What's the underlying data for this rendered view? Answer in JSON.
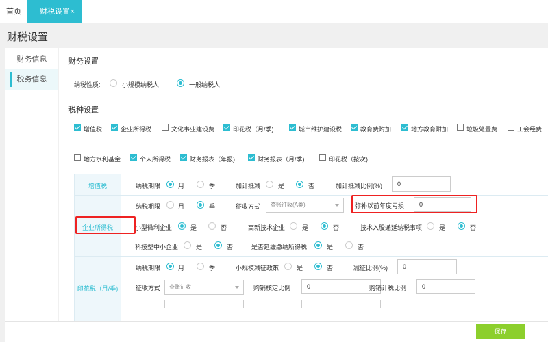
{
  "tabs": {
    "home": "首页",
    "active": "财税设置",
    "close": "×"
  },
  "page_title": "财税设置",
  "sidebar": {
    "items": [
      {
        "label": "财务信息"
      },
      {
        "label": "税务信息"
      }
    ]
  },
  "finance": {
    "title": "财务设置",
    "nature_label": "纳税性质:",
    "options": [
      {
        "label": "小规模纳税人",
        "selected": false
      },
      {
        "label": "一般纳税人",
        "selected": true
      }
    ]
  },
  "tax_types": {
    "title": "税种设置",
    "items": [
      {
        "label": "增值税",
        "checked": true
      },
      {
        "label": "企业所得税",
        "checked": true
      },
      {
        "label": "文化事业建设费",
        "checked": false
      },
      {
        "label": "印花税（月/季)",
        "checked": true
      },
      {
        "label": "城市维护建设税",
        "checked": true
      },
      {
        "label": "教育费附加",
        "checked": true
      },
      {
        "label": "地方教育附加",
        "checked": true
      },
      {
        "label": "垃圾处置费",
        "checked": false
      },
      {
        "label": "工会经费",
        "checked": false
      },
      {
        "label": "地方水利基金",
        "checked": false
      },
      {
        "label": "个人所得税",
        "checked": true
      },
      {
        "label": "财务报表（年报)",
        "checked": true
      },
      {
        "label": "财务报表（月/季)",
        "checked": true
      },
      {
        "label": "印花税（按次)",
        "checked": false
      }
    ]
  },
  "vat": {
    "header": "增值税",
    "period_label": "纳税期限",
    "period_month": "月",
    "period_quarter": "季",
    "deduct_label": "加计抵减",
    "yes": "是",
    "no": "否",
    "ratio_label": "加计抵减比例(%)",
    "ratio_value": "0"
  },
  "cit": {
    "header": "企业所得税",
    "period_label": "纳税期限",
    "period_month": "月",
    "period_quarter": "季",
    "collect_label": "征收方式",
    "collect_value": "查账征收(A类)",
    "loss_label": "弥补以前年度亏损",
    "loss_value": "0",
    "micro_label": "小型微利企业",
    "hightech_label": "高新技术企业",
    "tech_invest_label": "技术入股递延纳税事项",
    "sme_label": "科技型中小企业",
    "defer_label": "是否延缓缴纳所得税",
    "yes": "是",
    "no": "否"
  },
  "stamp": {
    "header": "印花税（月/季)",
    "period_label": "纳税期限",
    "period_month": "月",
    "period_quarter": "季",
    "small_policy_label": "小规模减征政策",
    "yes": "是",
    "no": "否",
    "reduce_label": "减征比例(%)",
    "reduce_value": "0",
    "collect_label": "征收方式",
    "collect_value": "查账征收",
    "purchase_label": "购销核定比例",
    "purchase_value": "0",
    "purchase_calc_label": "购销计税比例",
    "purchase_calc_value": "0"
  },
  "save_label": "保存",
  "colors": {
    "accent": "#2dbdd1",
    "save": "#8ccf2c",
    "highlight": "#e22222"
  }
}
